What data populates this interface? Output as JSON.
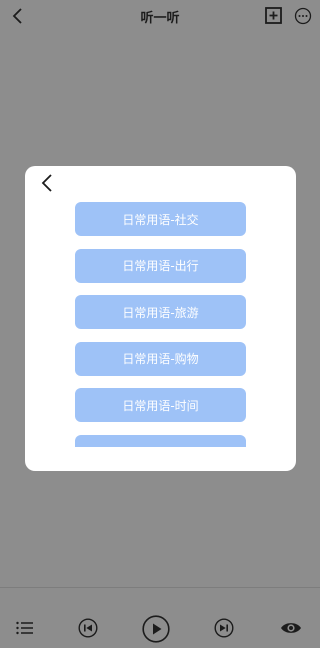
{
  "header": {
    "title": "听一听",
    "back_icon": "chevron-left-icon",
    "add_icon": "plus-square-icon",
    "more_icon": "ellipsis-circle-icon"
  },
  "modal": {
    "back_icon": "chevron-left-icon",
    "items": [
      {
        "label": "日常用语-社交"
      },
      {
        "label": "日常用语-出行"
      },
      {
        "label": "日常用语-旅游"
      },
      {
        "label": "日常用语-购物"
      },
      {
        "label": "日常用语-时间"
      },
      {
        "label": ""
      }
    ]
  },
  "player": {
    "icons": [
      "list-icon",
      "previous-icon",
      "play-icon",
      "next-icon",
      "eye-icon"
    ]
  },
  "colors": {
    "overlay": "#8d8d8d",
    "item_bg": "#9ec2f7",
    "item_text": "#ffffff"
  }
}
